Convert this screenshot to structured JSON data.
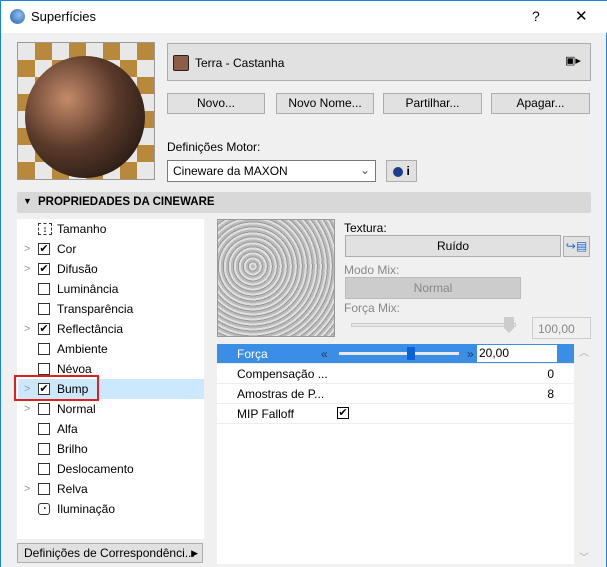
{
  "window": {
    "title": "Superfícies",
    "help": "?",
    "close": "✕"
  },
  "material": {
    "name": "Terra - Castanha",
    "swatch_color": "#8b5e45"
  },
  "buttons": {
    "new": "Novo...",
    "rename": "Novo Nome...",
    "share": "Partilhar...",
    "delete": "Apagar..."
  },
  "engine": {
    "label": "Definições Motor:",
    "value": "Cineware da MAXON",
    "info": "i"
  },
  "section": {
    "title": "PROPRIEDADES DA CINEWARE"
  },
  "channels": [
    {
      "label": "Tamanho",
      "kind": "size",
      "expand": false
    },
    {
      "label": "Cor",
      "checked": true,
      "expand": true
    },
    {
      "label": "Difusão",
      "checked": true,
      "expand": true
    },
    {
      "label": "Luminância",
      "checked": false,
      "expand": false
    },
    {
      "label": "Transparência",
      "checked": false,
      "expand": false
    },
    {
      "label": "Reflectância",
      "checked": true,
      "expand": true
    },
    {
      "label": "Ambiente",
      "checked": false,
      "expand": false
    },
    {
      "label": "Névoa",
      "checked": false,
      "expand": false
    },
    {
      "label": "Bump",
      "checked": true,
      "expand": true,
      "selected": true
    },
    {
      "label": "Normal",
      "checked": false,
      "expand": true
    },
    {
      "label": "Alfa",
      "checked": false,
      "expand": false
    },
    {
      "label": "Brilho",
      "checked": false,
      "expand": false
    },
    {
      "label": "Deslocamento",
      "checked": false,
      "expand": false
    },
    {
      "label": "Relva",
      "checked": false,
      "expand": true
    },
    {
      "label": "Iluminação",
      "kind": "light",
      "expand": false
    }
  ],
  "mapping_button": "Definições de Correspondênci...",
  "texture": {
    "label": "Textura:",
    "value": "Ruído",
    "mix_mode_label": "Modo Mix:",
    "mix_mode": "Normal",
    "mix_strength_label": "Força Mix:",
    "mix_strength": "100,00",
    "mix_strength_fraction": 1.0
  },
  "properties": [
    {
      "name": "Força",
      "value": "20,00",
      "slider_fraction": 0.6
    },
    {
      "name": "Compensação ...",
      "value": "0"
    },
    {
      "name": "Amostras de P...",
      "value": "8"
    },
    {
      "name": "MIP Falloff",
      "checked": true
    }
  ]
}
